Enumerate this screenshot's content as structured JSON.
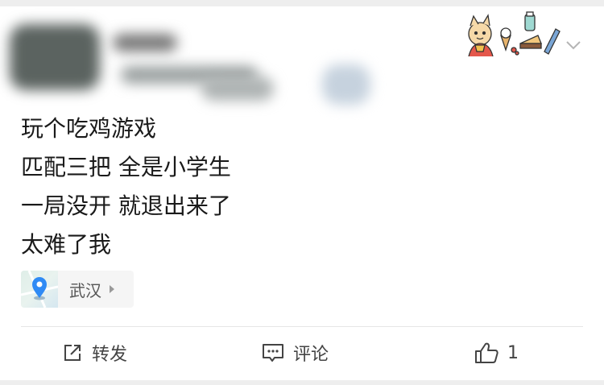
{
  "post": {
    "lines": [
      "玩个吃鸡游戏",
      "匹配三把 全是小学生",
      "一局没开 就退出来了",
      "太难了我"
    ]
  },
  "location": {
    "name": "武汉",
    "icon": "location-pin-icon"
  },
  "actions": {
    "forward_label": "转发",
    "comment_label": "评论",
    "like_count": "1"
  },
  "colors": {
    "text": "#1a1a1a",
    "secondary": "#444444",
    "pin_blue": "#2f8bf5",
    "divider": "#e6e6e6"
  }
}
